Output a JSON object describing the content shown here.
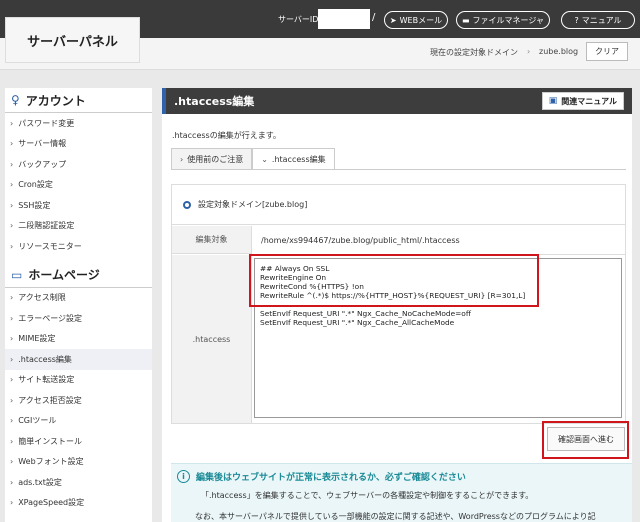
{
  "header": {
    "logo": "サーバーパネル",
    "server_id_label": "サーバーID",
    "slash": "/",
    "web_mail": "WEBメール",
    "file_manager": "ファイルマネージャ",
    "manual": "マニュアル",
    "current_domain_label": "現在の設定対象ドメイン",
    "domain_separator": "›",
    "current_domain": "zube.blog",
    "clear": "クリア"
  },
  "sidebar": {
    "account_title": "アカウント",
    "account_items": [
      "パスワード変更",
      "サーバー情報",
      "バックアップ",
      "Cron設定",
      "SSH設定",
      "二段階認証設定",
      "リソースモニター"
    ],
    "home_title": "ホームページ",
    "home_items": [
      "アクセス制限",
      "エラーページ設定",
      "MIME設定",
      ".htaccess編集",
      "サイト転送設定",
      "アクセス拒否設定",
      "CGIツール",
      "簡単インストール",
      "Webフォント設定",
      "ads.txt設定",
      "XPageSpeed設定"
    ]
  },
  "main": {
    "title": ".htaccess編集",
    "manual_button": "関連マニュアル",
    "intro": ".htaccessの編集が行えます。",
    "tabs": [
      {
        "label": "使用前のご注意"
      },
      {
        "label": ".htaccess編集"
      }
    ],
    "target_domain": "設定対象ドメイン[zube.blog]",
    "edit_target_label": "編集対象",
    "edit_target_path": "/home/xs994467/zube.blog/public_html/.htaccess",
    "htaccess_label": ".htaccess",
    "htaccess_content": "## Always On SSL\nRewriteEngine On\nRewriteCond %{HTTPS} !on\nRewriteRule ^(.*)$ https://%{HTTP_HOST}%{REQUEST_URI} [R=301,L]\n\nSetEnvIf Request_URI \".*\" Ngx_Cache_NoCacheMode=off\nSetEnvIf Request_URI \".*\" Ngx_Cache_AllCacheMode",
    "confirm_button": "確認画面へ進む"
  },
  "notice": {
    "title": "編集後はウェブサイトが正常に表示されるか、必ずご確認ください",
    "line1": "「.htaccess」を編集することで、ウェブサーバーの各種設定や制御をすることができます。",
    "line2": "なお、本サーバーパネルで提供している一部機能の設定に関する記述や、WordPressなどのプログラムにより記"
  }
}
